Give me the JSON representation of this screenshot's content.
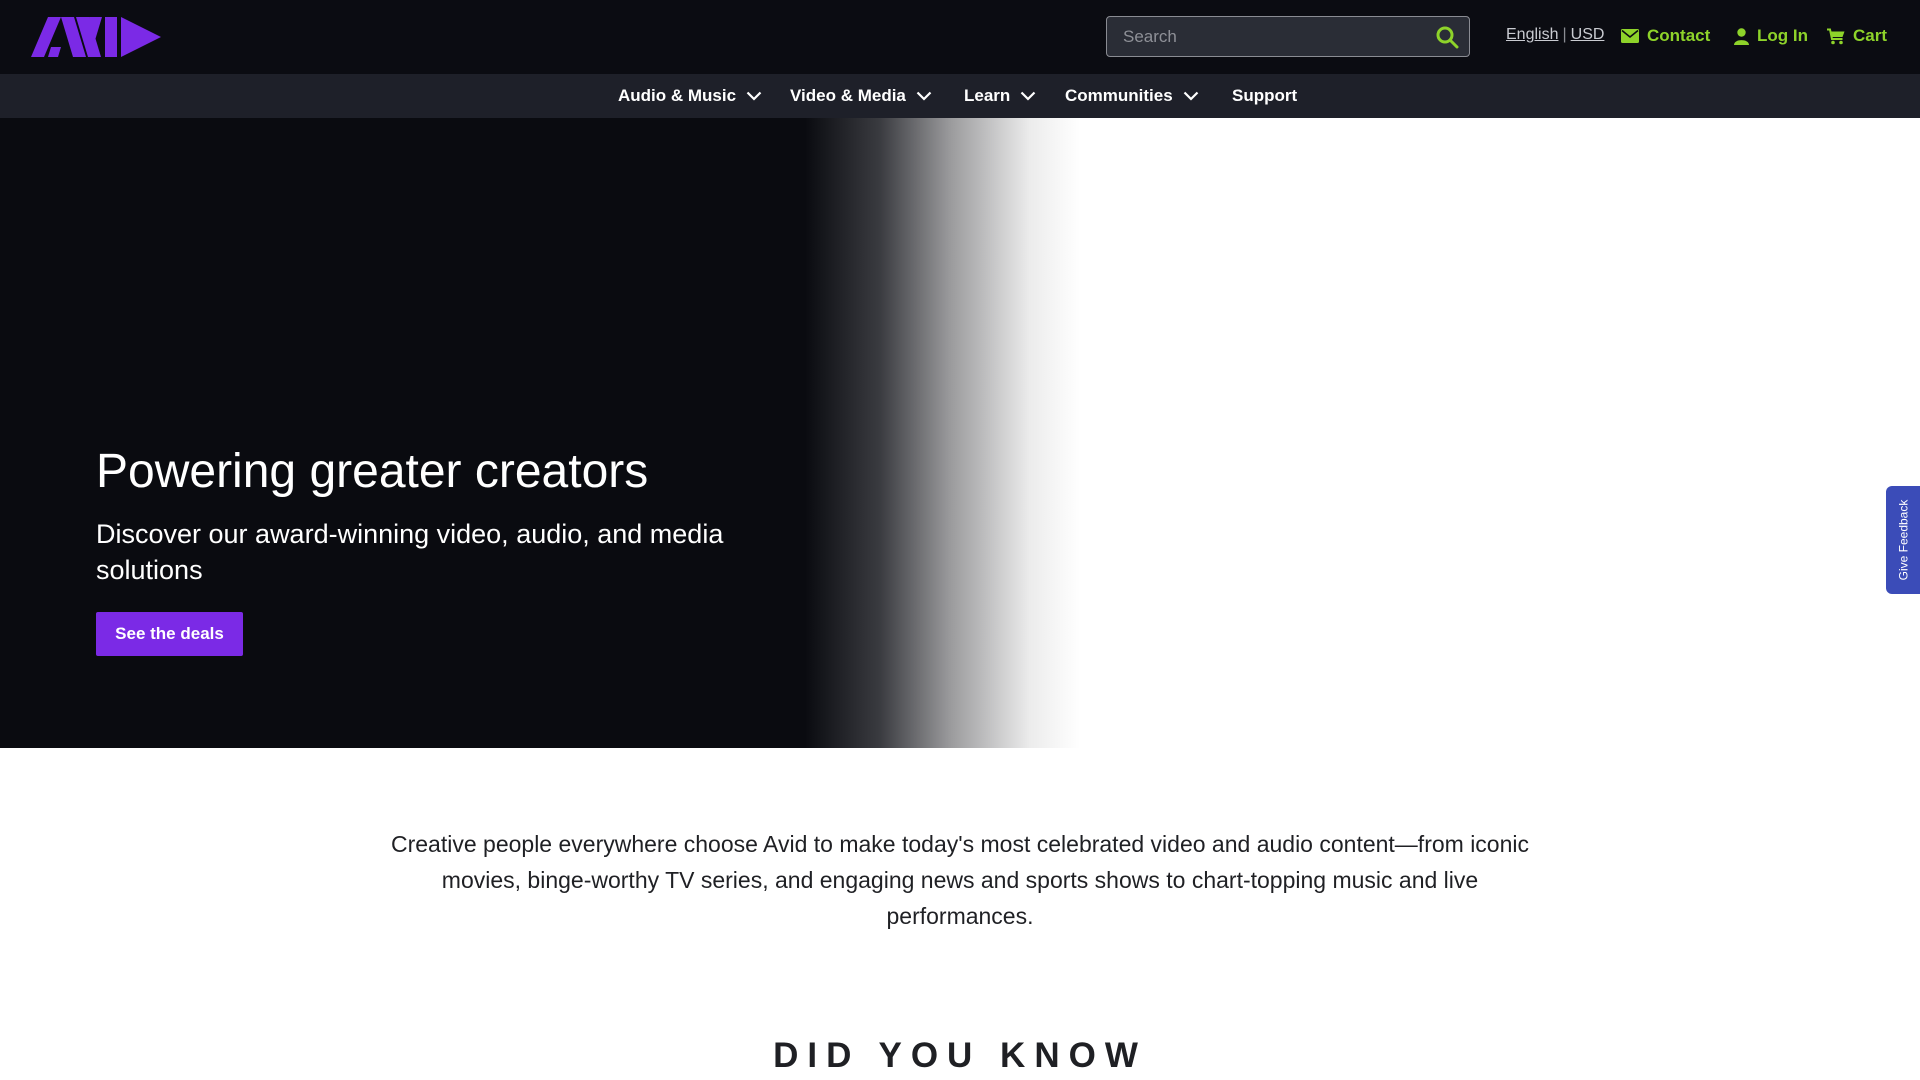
{
  "brand": {
    "logo": "AVID",
    "color": "#7b2ae6"
  },
  "search": {
    "placeholder": "Search",
    "icon": "search-icon"
  },
  "locale": {
    "language": "English",
    "separator": "|",
    "currency": "USD"
  },
  "utility_links": {
    "contact": {
      "label": "Contact",
      "icon": "envelope-icon"
    },
    "login": {
      "label": "Log In",
      "icon": "user-icon"
    },
    "cart": {
      "label": "Cart",
      "icon": "cart-icon"
    }
  },
  "colors": {
    "accent_green": "#8ed32a",
    "cta_purple": "#7b2ae6",
    "feedback_blue": "#3b4cb8"
  },
  "nav": {
    "items": [
      {
        "label": "Audio & Music",
        "has_dropdown": true
      },
      {
        "label": "Video & Media",
        "has_dropdown": true
      },
      {
        "label": "Learn",
        "has_dropdown": true
      },
      {
        "label": "Communities",
        "has_dropdown": true
      },
      {
        "label": "Support",
        "has_dropdown": false
      }
    ]
  },
  "hero": {
    "title": "Powering greater creators",
    "subtitle": "Discover our award-winning video, audio, and media solutions",
    "cta_label": "See the deals"
  },
  "feedback": {
    "label": "Give Feedback"
  },
  "intro": {
    "text": "Creative people everywhere choose Avid to make today's most celebrated video and audio content—from iconic movies, binge-worthy TV series, and engaging news and sports shows to chart-topping music and live performances."
  },
  "section": {
    "did_you_know": "DID YOU KNOW"
  }
}
